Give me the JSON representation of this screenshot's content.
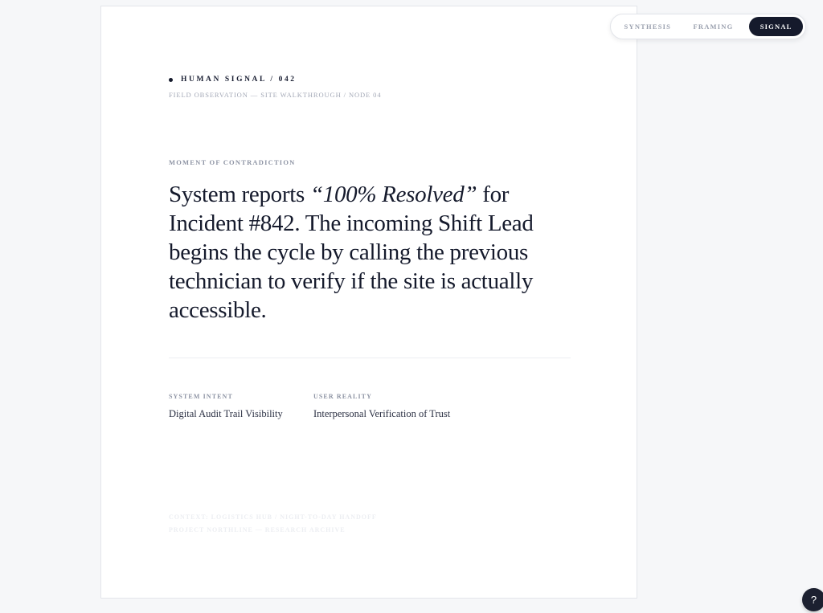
{
  "header": {
    "tag": "HUMAN SIGNAL / 042",
    "subline": "FIELD OBSERVATION — SITE WALKTHROUGH / NODE 04"
  },
  "moment": {
    "label": "MOMENT OF CONTRADICTION",
    "statement_before": "System reports ",
    "statement_quote": "“100% Resolved”",
    "statement_after": " for Incident #842. The incoming Shift Lead begins the cycle by calling the previous technician to verify if the site is actually accessible."
  },
  "meta": {
    "intent_label": "SYSTEM INTENT",
    "intent_value": "Digital Audit Trail Visibility",
    "reality_label": "USER REALITY",
    "reality_value": "Interpersonal Verification of Trust"
  },
  "footer": {
    "context": "CONTEXT: LOGISTICS HUB / NIGHT-TO-DAY HANDOFF",
    "project": "PROJECT NORTHLINE — RESEARCH ARCHIVE"
  },
  "view_toggle": {
    "synthesis": "SYNTHESIS",
    "framing": "FRAMING",
    "signal": "SIGNAL",
    "active": "SIGNAL"
  },
  "help": {
    "label": "?"
  },
  "colors": {
    "ink": "#151a2c",
    "muted": "#8e94a4",
    "background": "#f6f7f9"
  }
}
